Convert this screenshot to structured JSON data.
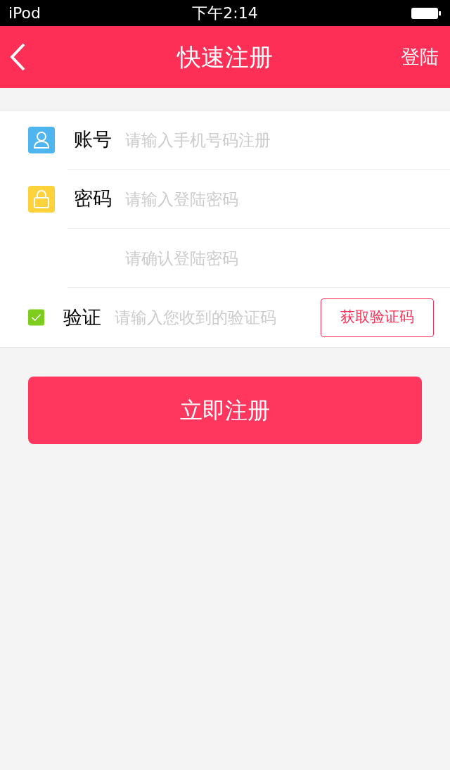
{
  "status_bar": {
    "carrier": "iPod",
    "time": "下午2:14"
  },
  "header": {
    "title": "快速注册",
    "action": "登陆"
  },
  "fields": [
    {
      "kind": "account",
      "label": "账号",
      "placeholder": "请输入手机号码注册"
    },
    {
      "kind": "password",
      "label": "密码",
      "placeholder": "请输入登陆密码"
    },
    {
      "kind": "confirm",
      "placeholder": "请确认登陆密码"
    },
    {
      "kind": "code",
      "label": "验证",
      "placeholder": "请输入您收到的验证码",
      "button": "获取验证码"
    }
  ],
  "submit": "立即注册"
}
